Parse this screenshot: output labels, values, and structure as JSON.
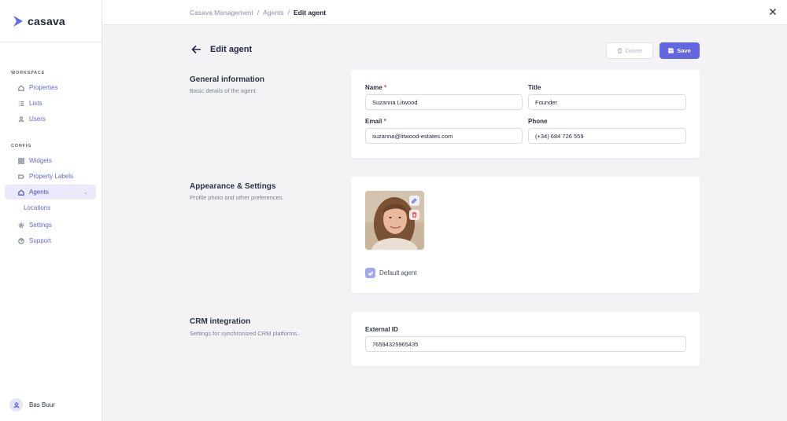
{
  "app": {
    "name": "casava"
  },
  "sidebar": {
    "workspace_label": "WORKSPACE",
    "workspace_items": [
      {
        "label": "Properties",
        "icon": "home-icon"
      },
      {
        "label": "Lists",
        "icon": "list-icon"
      },
      {
        "label": "Users",
        "icon": "user-icon"
      }
    ],
    "config_label": "CONFIG",
    "config_items": [
      {
        "label": "Widgets",
        "icon": "widgets-icon"
      },
      {
        "label": "Property Labels",
        "icon": "tag-icon"
      },
      {
        "label": "Agents",
        "icon": "home-icon",
        "active": true
      },
      {
        "label": "Locations",
        "sub": true
      },
      {
        "label": "Settings",
        "icon": "gear-icon"
      },
      {
        "label": "Support",
        "icon": "help-icon"
      }
    ],
    "user_name": "Bas Buur"
  },
  "breadcrumb": {
    "items": [
      "Casava Management",
      "Agents"
    ],
    "current": "Edit agent",
    "separator": "/"
  },
  "page": {
    "title": "Edit agent",
    "delete_label": "Delete",
    "save_label": "Save"
  },
  "sections": {
    "general": {
      "title": "General information",
      "desc": "Basic details of the agent.",
      "name_label": "Name",
      "name_value": "Suzanna Litwood",
      "title_label": "Title",
      "title_value": "Founder",
      "email_label": "Email",
      "email_value": "suzanna@litwood-estates.com",
      "phone_label": "Phone",
      "phone_value": "(+34) 684 726 559",
      "required_mark": "*"
    },
    "appearance": {
      "title": "Appearance & Settings",
      "desc": "Profile photo and other preferences.",
      "default_agent_label": "Default agent",
      "default_agent_checked": true
    },
    "crm": {
      "title": "CRM integration",
      "desc": "Settings for synchronized CRM platforms.",
      "external_id_label": "External ID",
      "external_id_value": "76594325965435"
    }
  },
  "colors": {
    "accent": "#6366e0",
    "required": "#e0454f",
    "sidebar_active_bg": "#eaeafb"
  }
}
